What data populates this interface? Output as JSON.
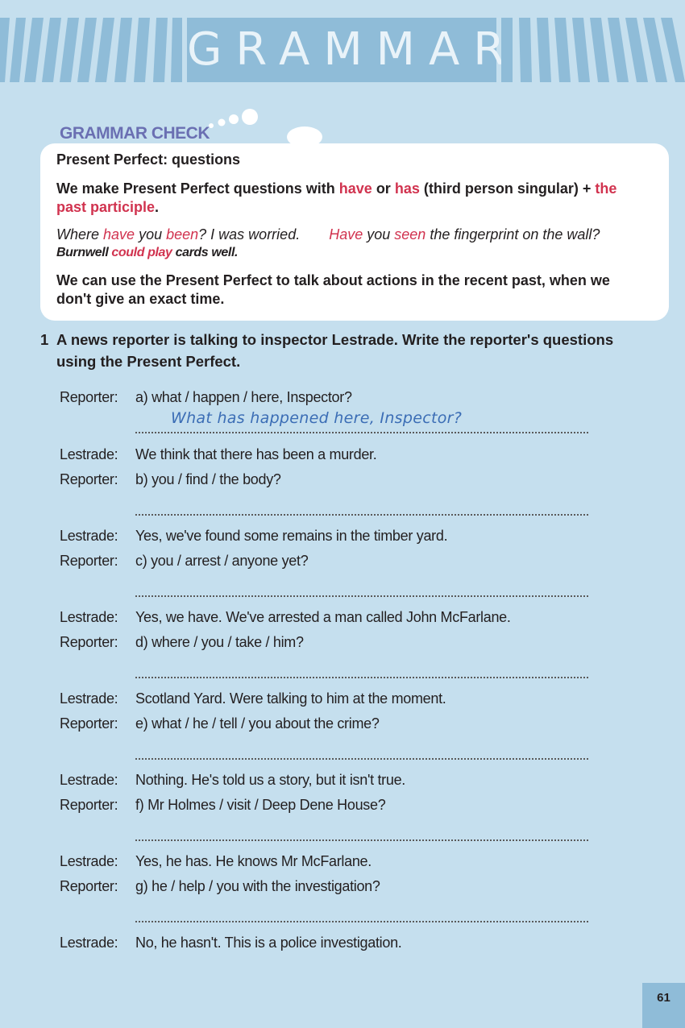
{
  "banner": {
    "title": "GRAMMAR"
  },
  "grammar_check": {
    "label": "GRAMMAR CHECK",
    "title": "Present Perfect: questions",
    "rule1": {
      "a": "We make Present Perfect questions with ",
      "have": "have",
      "b": " or ",
      "has": "has",
      "c": " (third person singular) + ",
      "pp": "the past participle",
      "d": "."
    },
    "example1": {
      "a": "Where ",
      "have": "have",
      "b": " you ",
      "been": "been",
      "c": "? I was worried."
    },
    "example2": {
      "have": "Have",
      "a": " you ",
      "seen": "seen",
      "b": " the fingerprint on the wall?"
    },
    "example3": {
      "a": "Burnwell ",
      "could_play": "could play",
      "b": " cards well."
    },
    "rule2": "We can use the Present Perfect to talk about actions in the recent past, when we don't give an exact time."
  },
  "exercise": {
    "number": "1",
    "instruction": "A news reporter is talking to inspector Lestrade. Write the reporter's questions using the Present Perfect.",
    "lines": [
      {
        "speaker": "Reporter:",
        "text": "a) what  /  happen  /  here,  Inspector?"
      },
      {
        "speaker": "Lestrade:",
        "text": "We think that there has been a murder."
      },
      {
        "speaker": "Reporter:",
        "text": "b) you / find / the body?"
      },
      {
        "speaker": "Lestrade:",
        "text": "Yes, we've found some remains in the timber yard."
      },
      {
        "speaker": "Reporter:",
        "text": "c) you / arrest / anyone yet?"
      },
      {
        "speaker": "Lestrade:",
        "text": "Yes, we have. We've arrested a man called John McFarlane."
      },
      {
        "speaker": "Reporter:",
        "text": "d) where / you / take / him?"
      },
      {
        "speaker": "Lestrade:",
        "text": "Scotland Yard. Were talking to him at the moment."
      },
      {
        "speaker": "Reporter:",
        "text": "e) what / he / tell / you about the crime?"
      },
      {
        "speaker": "Lestrade:",
        "text": "Nothing. He's told us a story, but it isn't true."
      },
      {
        "speaker": "Reporter:",
        "text": "f) Mr Holmes / visit / Deep Dene House?"
      },
      {
        "speaker": "Lestrade:",
        "text": "Yes, he has. He knows Mr McFarlane."
      },
      {
        "speaker": "Reporter:",
        "text": "g) he / help / you with the investigation?"
      },
      {
        "speaker": "Lestrade:",
        "text": "No, he hasn't. This is a police investigation."
      }
    ],
    "answers": [
      "What has happened here, Inspector?",
      "",
      "",
      "",
      "",
      "",
      ""
    ]
  },
  "page_number": "61",
  "colors": {
    "page_bg": "#c5dfee",
    "banner": "#8fbcd8",
    "accent_red": "#d1334f",
    "heading_purple": "#6a6fb2"
  }
}
